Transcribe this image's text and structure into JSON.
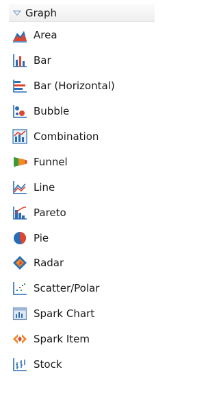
{
  "group": {
    "title": "Graph",
    "items": [
      {
        "label": "Area",
        "icon": "area-chart-icon"
      },
      {
        "label": "Bar",
        "icon": "bar-chart-icon"
      },
      {
        "label": "Bar (Horizontal)",
        "icon": "horizontal-bar-chart-icon"
      },
      {
        "label": "Bubble",
        "icon": "bubble-chart-icon"
      },
      {
        "label": "Combination",
        "icon": "combination-chart-icon"
      },
      {
        "label": "Funnel",
        "icon": "funnel-chart-icon"
      },
      {
        "label": "Line",
        "icon": "line-chart-icon"
      },
      {
        "label": "Pareto",
        "icon": "pareto-chart-icon"
      },
      {
        "label": "Pie",
        "icon": "pie-chart-icon"
      },
      {
        "label": "Radar",
        "icon": "radar-chart-icon"
      },
      {
        "label": "Scatter/Polar",
        "icon": "scatter-chart-icon"
      },
      {
        "label": "Spark Chart",
        "icon": "spark-chart-icon"
      },
      {
        "label": "Spark Item",
        "icon": "spark-item-icon"
      },
      {
        "label": "Stock",
        "icon": "stock-chart-icon"
      }
    ]
  },
  "colors": {
    "blue": "#2a6db5",
    "red": "#e0452f",
    "orange": "#f08a24",
    "green": "#3a9a3a",
    "caret": "#8fa9c9"
  }
}
